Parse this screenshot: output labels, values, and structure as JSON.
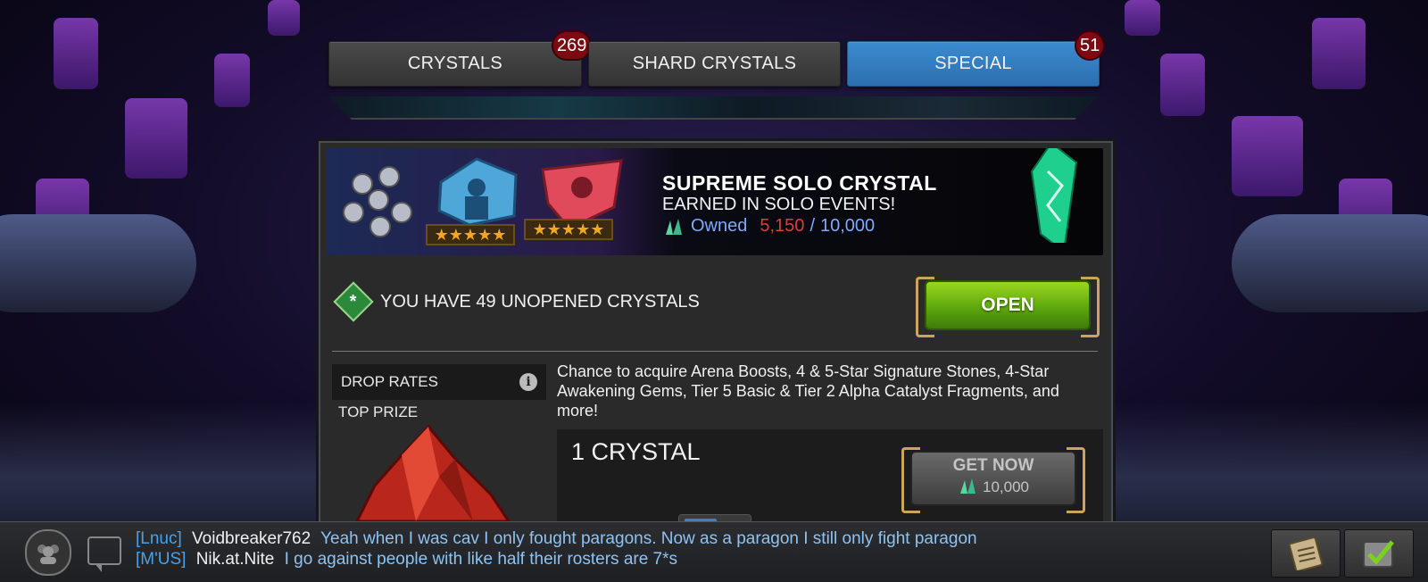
{
  "tabs": [
    {
      "label": "CRYSTALS",
      "badge": "269",
      "active": false
    },
    {
      "label": "SHARD CRYSTALS",
      "badge": "",
      "active": false
    },
    {
      "label": "SPECIAL",
      "badge": "51",
      "active": true
    }
  ],
  "banner": {
    "title": "SUPREME SOLO CRYSTAL",
    "subtitle": "EARNED IN SOLO EVENTS!",
    "owned_label": "Owned",
    "owned_current": "5,150",
    "owned_separator": "/",
    "owned_total": "10,000",
    "star_rating": 5
  },
  "unopened": {
    "icon": "asterisk-diamond-icon",
    "text": "YOU HAVE 49 UNOPENED CRYSTALS"
  },
  "open_button": {
    "label": "OPEN"
  },
  "drop_rates": {
    "label": "DROP RATES",
    "info_icon": "i"
  },
  "top_prize": {
    "label": "TOP PRIZE"
  },
  "description": "Chance to acquire Arena Boosts, 4 & 5-Star Signature Stones, 4-Star Awakening Gems, Tier 5 Basic & Tier 2 Alpha Catalyst Fragments, and more!",
  "purchase": {
    "quantity": "1 CRYSTAL",
    "button_label": "GET NOW",
    "price": "10,000"
  },
  "chat": {
    "messages": [
      {
        "tag": "[Lnuc]",
        "user": "Voidbreaker762",
        "text": "Yeah when I was cav I only fought paragons. Now as a paragon I still only fight paragon"
      },
      {
        "tag": "[M'US]",
        "user": "Nik.at.Nite",
        "text": "I go against people with like half their rosters are 7*s"
      }
    ]
  },
  "colors": {
    "active_tab": "#2c6fae",
    "open_button": "#5ea80e",
    "owned_current": "#e23a3a",
    "owned_total": "#7fa8ff",
    "badge": "#7d0a12"
  }
}
